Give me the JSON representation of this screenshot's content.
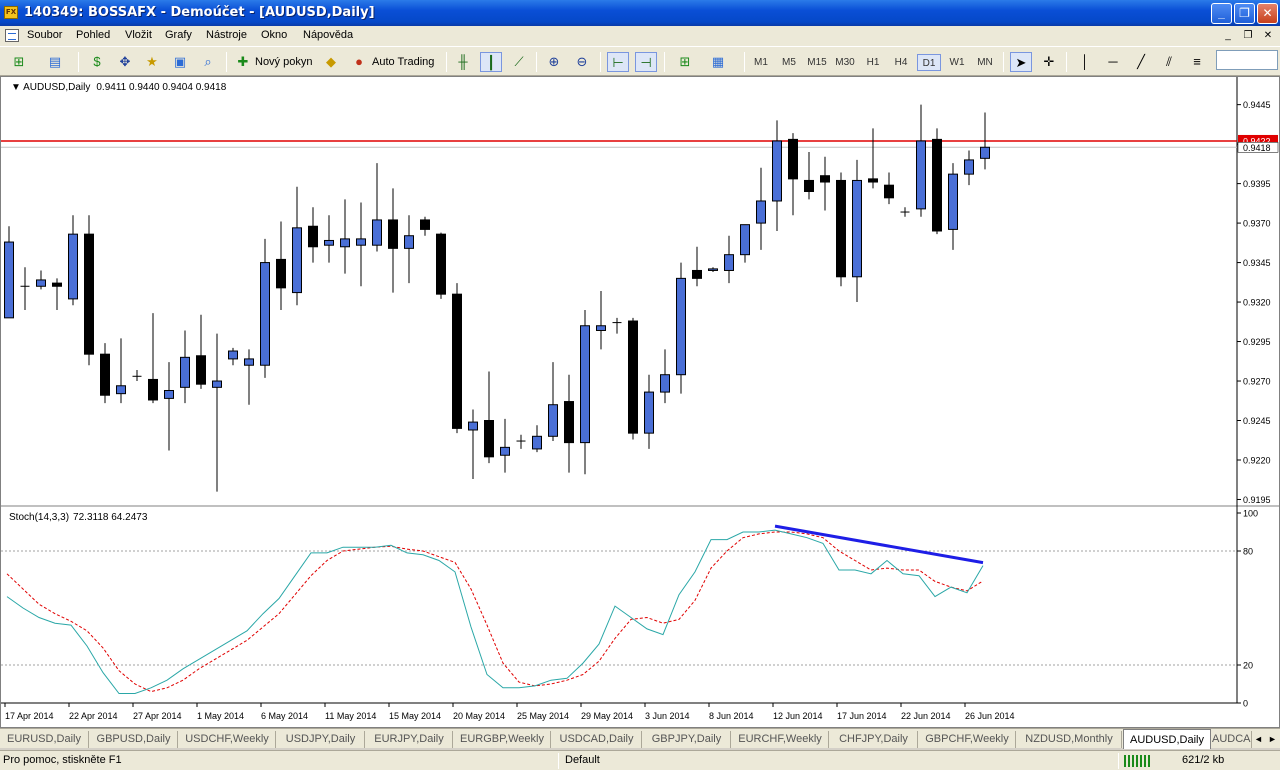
{
  "window": {
    "title": "140349: BOSSAFX - Demoúčet - [AUDUSD,Daily]",
    "app_icon": "FX",
    "controls": [
      "_",
      "❐",
      "✕"
    ]
  },
  "menu": {
    "items": [
      "Soubor",
      "Pohled",
      "Vložit",
      "Grafy",
      "Nástroje",
      "Okno",
      "Nápověda"
    ],
    "mdi_controls": [
      "_",
      "❐",
      "✕"
    ]
  },
  "toolbar": {
    "new_order_label": "Nový pokyn",
    "auto_trading_label": "Auto Trading",
    "timeframes": [
      "M1",
      "M5",
      "M15",
      "M30",
      "H1",
      "H4",
      "D1",
      "W1",
      "MN"
    ],
    "active_timeframe": "D1"
  },
  "chart_data": [
    {
      "type": "candlestick",
      "header": "AUDUSD,Daily  0.9411 0.9440 0.9404 0.9418",
      "symbol": "AUDUSD,Daily",
      "ohlc_readout": "0.9411 0.9440 0.9404 0.9418",
      "yticks": [
        "0.9445",
        "0.9420",
        "0.9395",
        "0.9370",
        "0.9345",
        "0.9320",
        "0.9295",
        "0.9270",
        "0.9245",
        "0.9220",
        "0.9195"
      ],
      "ylim": [
        0.91915,
        0.94625
      ],
      "hline": {
        "price": 0.9422,
        "label": "0.9422",
        "color": "#e00000"
      },
      "bid_line": {
        "price": 0.9418,
        "label": "0.9418"
      },
      "up_color": "#4a6fd6",
      "down_color": "#000000",
      "candles": [
        [
          0.931,
          0.9368,
          0.9322,
          0.9358
        ],
        [
          0.933,
          0.9342,
          0.9315,
          0.933
        ],
        [
          0.933,
          0.934,
          0.9328,
          0.9334
        ],
        [
          0.9332,
          0.9335,
          0.9315,
          0.933
        ],
        [
          0.9322,
          0.9375,
          0.9318,
          0.9363
        ],
        [
          0.9363,
          0.9375,
          0.928,
          0.9287
        ],
        [
          0.9287,
          0.9294,
          0.9256,
          0.9261
        ],
        [
          0.9262,
          0.9297,
          0.9256,
          0.9267
        ],
        [
          0.9273,
          0.9277,
          0.927,
          0.9273
        ],
        [
          0.9271,
          0.9313,
          0.9256,
          0.9258
        ],
        [
          0.9259,
          0.9282,
          0.9226,
          0.9264
        ],
        [
          0.9266,
          0.9302,
          0.9256,
          0.9285
        ],
        [
          0.9286,
          0.9312,
          0.9265,
          0.9268
        ],
        [
          0.9266,
          0.93,
          0.92,
          0.927
        ],
        [
          0.9284,
          0.9291,
          0.928,
          0.9289
        ],
        [
          0.928,
          0.929,
          0.9255,
          0.9284
        ],
        [
          0.928,
          0.936,
          0.9272,
          0.9345
        ],
        [
          0.9347,
          0.9371,
          0.9315,
          0.9329
        ],
        [
          0.9326,
          0.9393,
          0.9318,
          0.9367
        ],
        [
          0.9368,
          0.938,
          0.9345,
          0.9355
        ],
        [
          0.9356,
          0.9375,
          0.9345,
          0.9359
        ],
        [
          0.9355,
          0.9385,
          0.9338,
          0.936
        ],
        [
          0.9356,
          0.9383,
          0.933,
          0.936
        ],
        [
          0.9356,
          0.9408,
          0.9352,
          0.9372
        ],
        [
          0.9372,
          0.9392,
          0.9326,
          0.9354
        ],
        [
          0.9354,
          0.9375,
          0.9332,
          0.9362
        ],
        [
          0.9372,
          0.9374,
          0.9362,
          0.9366
        ],
        [
          0.9363,
          0.9364,
          0.9322,
          0.9325
        ],
        [
          0.9325,
          0.9332,
          0.9237,
          0.924
        ],
        [
          0.9239,
          0.9252,
          0.9208,
          0.9244
        ],
        [
          0.9245,
          0.9276,
          0.9218,
          0.9222
        ],
        [
          0.9223,
          0.9246,
          0.9212,
          0.9228
        ],
        [
          0.9232,
          0.9236,
          0.9227,
          0.9232
        ],
        [
          0.9227,
          0.9242,
          0.9225,
          0.9235
        ],
        [
          0.9235,
          0.9282,
          0.9232,
          0.9255
        ],
        [
          0.9257,
          0.9274,
          0.9212,
          0.9231
        ],
        [
          0.9231,
          0.9315,
          0.9211,
          0.9305
        ],
        [
          0.9302,
          0.9327,
          0.929,
          0.9305
        ],
        [
          0.9307,
          0.931,
          0.93,
          0.9307
        ],
        [
          0.9308,
          0.931,
          0.9233,
          0.9237
        ],
        [
          0.9237,
          0.9274,
          0.9227,
          0.9263
        ],
        [
          0.9263,
          0.929,
          0.9256,
          0.9274
        ],
        [
          0.9274,
          0.9345,
          0.9262,
          0.9335
        ],
        [
          0.934,
          0.9355,
          0.933,
          0.9335
        ],
        [
          0.934,
          0.9342,
          0.9339,
          0.9341
        ],
        [
          0.934,
          0.9362,
          0.9332,
          0.935
        ],
        [
          0.935,
          0.9364,
          0.9345,
          0.9369
        ],
        [
          0.937,
          0.9405,
          0.9353,
          0.9384
        ],
        [
          0.9384,
          0.9435,
          0.9365,
          0.9422
        ],
        [
          0.9423,
          0.9427,
          0.9375,
          0.9398
        ],
        [
          0.9397,
          0.9415,
          0.9385,
          0.939
        ],
        [
          0.94,
          0.9412,
          0.9378,
          0.9396
        ],
        [
          0.9397,
          0.9402,
          0.933,
          0.9336
        ],
        [
          0.9336,
          0.941,
          0.932,
          0.9397
        ],
        [
          0.9398,
          0.943,
          0.9392,
          0.9396
        ],
        [
          0.9394,
          0.9402,
          0.9382,
          0.9386
        ],
        [
          0.9377,
          0.938,
          0.9374,
          0.9377
        ],
        [
          0.9379,
          0.9445,
          0.9374,
          0.9422
        ],
        [
          0.9423,
          0.943,
          0.9363,
          0.9365
        ],
        [
          0.9366,
          0.9408,
          0.9353,
          0.9401
        ],
        [
          0.9401,
          0.9416,
          0.9394,
          0.941
        ],
        [
          0.9411,
          0.944,
          0.9404,
          0.9418
        ]
      ]
    },
    {
      "type": "line",
      "header": "Stoch(14,3,3) 72.3118 64.2473",
      "indicator": "Stoch(14,3,3)",
      "values_readout": "72.3118 64.2473",
      "yticks": [
        "100",
        "80",
        "20",
        "0"
      ],
      "ylim": [
        0,
        100
      ],
      "levels": [
        80,
        20
      ],
      "main_color": "#2aa7a7",
      "signal_color": "#e00000",
      "trendline_color": "#1e1ee6",
      "trendline": {
        "from": [
          48,
          91.5
        ],
        "to": [
          61,
          72.3
        ]
      },
      "main": [
        56,
        50,
        45,
        42,
        41,
        30,
        16,
        5,
        5,
        8,
        12,
        18,
        23,
        28,
        33,
        38,
        47,
        55,
        67,
        79,
        79,
        82,
        82,
        82,
        83,
        79,
        78,
        75,
        69,
        40,
        15,
        8,
        8,
        9,
        12,
        13,
        21,
        31,
        51,
        45,
        39,
        36,
        57,
        69,
        86,
        86,
        90,
        90,
        91,
        89,
        87,
        84,
        70,
        70,
        68,
        75,
        68,
        67,
        56,
        61,
        58,
        72.3118
      ],
      "signal": [
        68,
        60,
        52,
        47,
        43,
        38,
        29,
        17,
        10,
        6,
        8,
        12,
        18,
        23,
        28,
        33,
        40,
        47,
        57,
        67,
        75,
        80,
        81,
        82,
        82.5,
        81,
        80,
        77,
        74,
        60,
        41,
        21,
        11,
        9,
        10,
        12,
        15,
        22,
        34,
        44,
        45,
        42,
        44,
        54,
        71,
        80,
        87,
        89,
        90,
        90,
        89,
        87,
        80,
        75,
        70,
        71,
        70,
        70,
        64,
        61,
        59,
        64.2473
      ]
    }
  ],
  "x_axis": {
    "labels": [
      "17 Apr 2014",
      "22 Apr 2014",
      "27 Apr 2014",
      "1 May 2014",
      "6 May 2014",
      "11 May 2014",
      "15 May 2014",
      "20 May 2014",
      "25 May 2014",
      "29 May 2014",
      "3 Jun 2014",
      "8 Jun 2014",
      "12 Jun 2014",
      "17 Jun 2014",
      "22 Jun 2014",
      "26 Jun 2014"
    ],
    "label_bar_index": [
      0,
      4,
      8,
      12,
      16,
      20,
      24,
      28,
      32,
      36,
      40,
      44,
      48,
      52,
      56,
      60
    ]
  },
  "tabs": {
    "items": [
      "EURUSD,Daily",
      "GBPUSD,Daily",
      "USDCHF,Weekly",
      "USDJPY,Daily",
      "EURJPY,Daily",
      "EURGBP,Weekly",
      "USDCAD,Daily",
      "GBPJPY,Daily",
      "EURCHF,Weekly",
      "CHFJPY,Daily",
      "GBPCHF,Weekly",
      "NZDUSD,Monthly",
      "AUDUSD,Daily",
      "AUDCAD,Daily"
    ],
    "active": "AUDUSD,Daily",
    "scroll_left": "◄",
    "scroll_right": "►"
  },
  "status": {
    "help": "Pro pomoc, stiskněte F1",
    "profile": "Default",
    "traffic": "621/2 kb"
  }
}
